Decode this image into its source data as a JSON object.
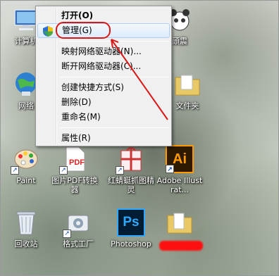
{
  "desktop": {
    "icons": {
      "computer": "计算机",
      "network": "网络",
      "paint": "Paint",
      "pdf": "图片PDF转换器",
      "hongqing": "红蜻蜓抓图精灵",
      "ai": "Adobe Illustrat...",
      "recycle": "回收站",
      "geshi": "格式工厂",
      "photoshop": "Photoshop",
      "top_right": "頭震",
      "folder": "文件夹"
    },
    "ai_logo": "Ai",
    "ps_logo": "Ps"
  },
  "context_menu": {
    "items": [
      {
        "label": "打开(O)"
      },
      {
        "label": "管理(G)"
      },
      {
        "label": "映射网络驱动器(N)..."
      },
      {
        "label": "断开网络驱动器(C)..."
      },
      {
        "label": "创建快捷方式(S)"
      },
      {
        "label": "删除(D)"
      },
      {
        "label": "重命名(M)"
      },
      {
        "label": "属性(R)"
      }
    ]
  },
  "colors": {
    "annotation_red": "#d81818",
    "menu_bg": "#f0f0f0",
    "highlight_border": "#aecff7"
  }
}
